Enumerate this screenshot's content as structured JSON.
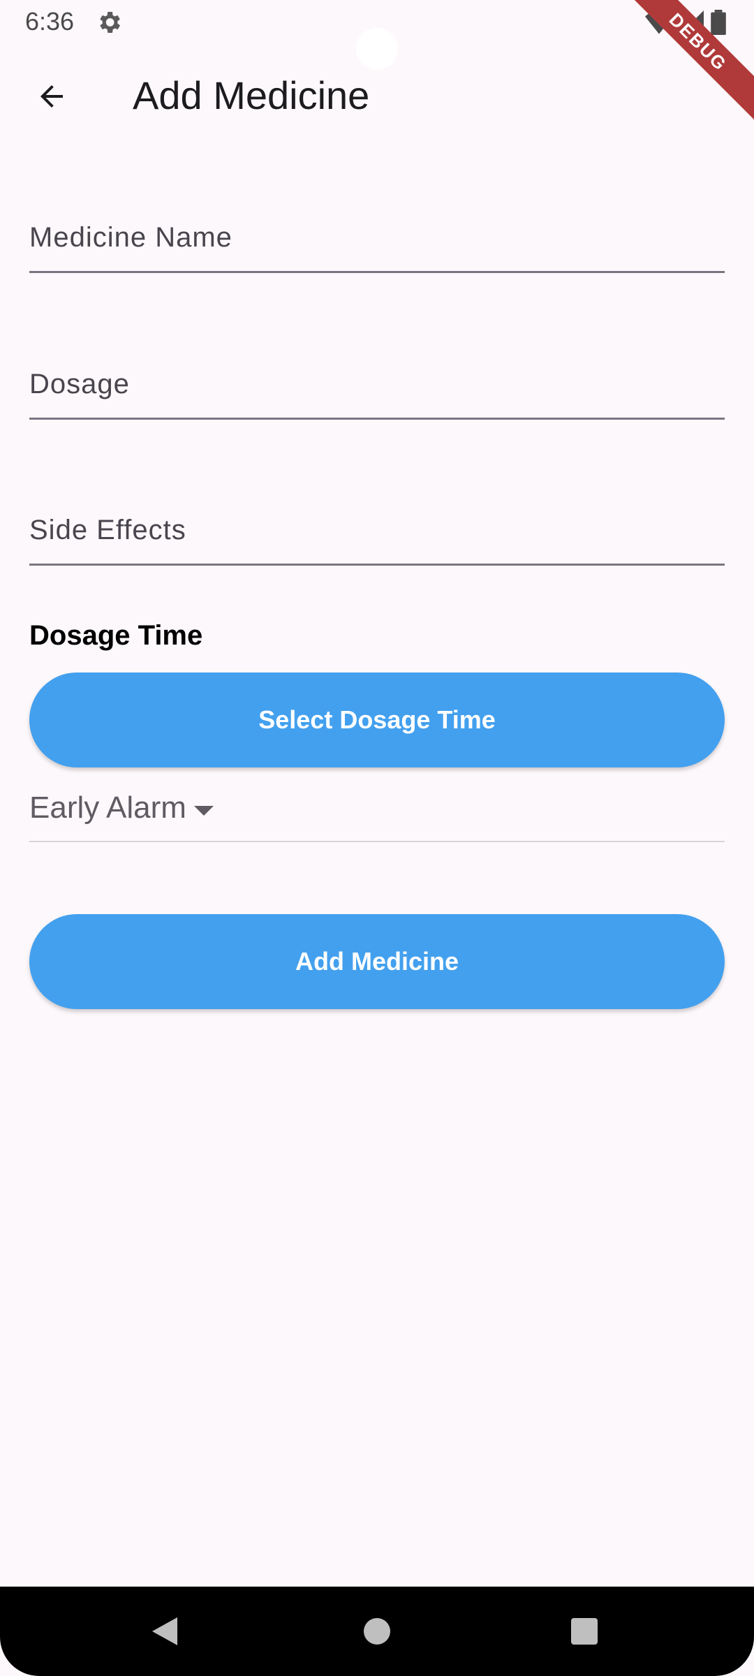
{
  "status_bar": {
    "time": "6:36",
    "icons": [
      "gear-icon",
      "wifi-icon",
      "signal-icon",
      "battery-icon"
    ]
  },
  "debug_banner": "DEBUG",
  "app_bar": {
    "title": "Add Medicine",
    "back_icon": "arrow-left-icon"
  },
  "form": {
    "medicine_name_label": "Medicine Name",
    "dosage_label": "Dosage",
    "side_effects_label": "Side Effects",
    "dosage_time_heading": "Dosage Time",
    "select_dosage_time_button": "Select Dosage Time",
    "early_alarm_label": "Early Alarm",
    "add_medicine_button": "Add Medicine"
  },
  "colors": {
    "background": "#fdf8fb",
    "primary_button": "#43a0ee",
    "button_text": "#ffffff",
    "debug_ribbon": "#b03a3a"
  },
  "nav_bar": {
    "icons": [
      "back-triangle-icon",
      "home-circle-icon",
      "recents-square-icon"
    ]
  }
}
